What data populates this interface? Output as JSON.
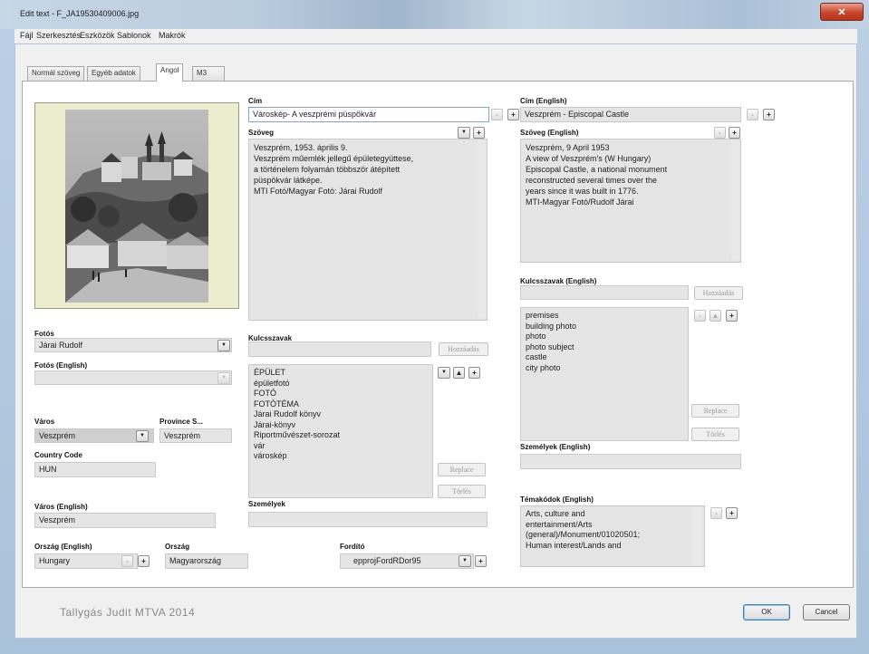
{
  "window": {
    "title": "Edit text - F_JA19530409006.jpg",
    "close_glyph": "✕"
  },
  "menu": [
    "Fájl",
    "Szerkesztés",
    "Eszközök",
    "Sablonok",
    "Makrók"
  ],
  "tabs": [
    {
      "label": "Normál szöveg",
      "active": false
    },
    {
      "label": "Egyéb adatok",
      "active": false
    },
    {
      "label": "Angol",
      "active": true
    },
    {
      "label": "M3",
      "active": false
    }
  ],
  "left": {
    "fotos_label": "Fotós",
    "fotos_value": "Járai Rudolf",
    "fotos_en_label": "Fotós (English)",
    "fotos_en_value": "",
    "varos_label": "Város",
    "varos_value": "Veszprém",
    "province_label": "Province S...",
    "province_value": "Veszprém",
    "country_code_label": "Country Code",
    "country_code_value": "HUN",
    "varos_en_label": "Város (English)",
    "varos_en_value": "Veszprém",
    "orszag_en_label": "Ország (English)",
    "orszag_en_value": "Hungary",
    "orszag_label": "Ország",
    "orszag_value": "Magyarország"
  },
  "middle": {
    "cim_label": "Cím",
    "cim_value": "Városkép- A veszprémi püspökvár",
    "szoveg_label": "Szöveg",
    "szoveg_value": "Veszprém, 1953. április 9.\nVeszprém műemlék jellegű épületegyüttese,\na történelem folyamán többször átépített\npüspökvár látképe.\nMTI Fotó/Magyar Fotó: Járai Rudolf",
    "kulcsszavak_label": "Kulcsszavak",
    "hozzaadas_label": "Hozzáadás",
    "keywords": [
      "ÉPÜLET",
      "épületfotó",
      "FOTÓ",
      "FOTÓTÉMA",
      "Járai Rudolf könyv",
      "Járai-könyv",
      "Riportművészet-sorozat",
      "vár",
      "városkép"
    ],
    "replace_label": "Replace",
    "torles_label": "Törlés",
    "szemelyek_label": "Személyek",
    "szemelyek_value": "",
    "fordito_label": "Fordító",
    "fordito_value": "epprojFordRDor95"
  },
  "right": {
    "cim_en_label": "Cím (English)",
    "cim_en_value": "Veszprém - Episcopal Castle",
    "szoveg_en_label": "Szöveg (English)",
    "szoveg_en_value": "Veszprém, 9 April 1953\nA view of Veszprém's (W Hungary)\nEpiscopal Castle, a national monument\nreconstructed several times over the\nyears since it was built in 1776.\nMTI-Magyar Fotó/Rudolf Járai",
    "kulcsszavak_en_label": "Kulcsszavak (English)",
    "hozzaadas_label": "Hozzáadás",
    "keywords_en": [
      "premises",
      "building photo",
      "photo",
      "photo subject",
      "castle",
      "city photo"
    ],
    "replace_label": "Replace",
    "torles_label": "Törlés",
    "szemelyek_en_label": "Személyek (English)",
    "szemelyek_en_value": "",
    "temakodok_en_label": "Témakódok (English)",
    "temakodok_en_value": "Arts, culture and\nentertainment/Arts\n(general)/Monument/01020501;\nHuman interest/Lands and"
  },
  "footer": {
    "signature": "Tallygás Judit MTVA 2014",
    "ok_label": "OK",
    "cancel_label": "Cancel"
  },
  "icons": {
    "plus": "+",
    "minus": "-",
    "dropdown": "▼",
    "up": "▲",
    "down": "▼"
  }
}
